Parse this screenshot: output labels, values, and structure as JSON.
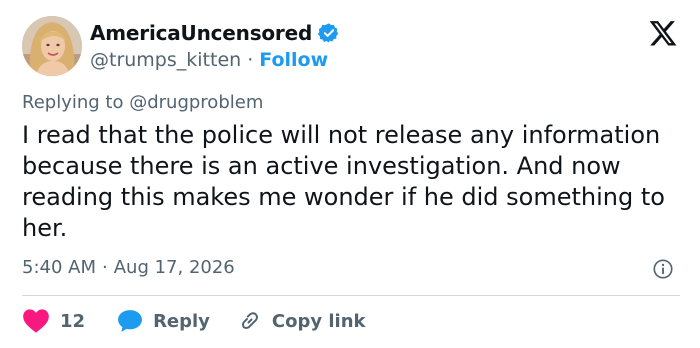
{
  "author": {
    "display_name": "AmericaUncensored",
    "handle": "@trumps_kitten",
    "separator": "·",
    "follow_label": "Follow",
    "verified": true
  },
  "reply_context": {
    "prefix": "Replying to",
    "handle": "@drugproblem"
  },
  "tweet": {
    "text": "I read that the police will not release any information because there is an active investigation. And now reading this makes me wonder if he did something to her."
  },
  "meta": {
    "time": "5:40 AM",
    "separator": "·",
    "date": "Aug 17, 2026"
  },
  "actions": {
    "like_count": "12",
    "reply_label": "Reply",
    "copy_link_label": "Copy link"
  },
  "colors": {
    "accent": "#1d9bf0",
    "like": "#f91880",
    "text_primary": "#0f1419",
    "text_secondary": "#536471",
    "divider": "#cfd9de"
  },
  "icons": {
    "platform": "x-logo-icon",
    "verified": "verified-badge-icon",
    "info": "info-icon",
    "like": "heart-icon",
    "reply": "speech-bubble-icon",
    "copy_link": "link-icon"
  }
}
